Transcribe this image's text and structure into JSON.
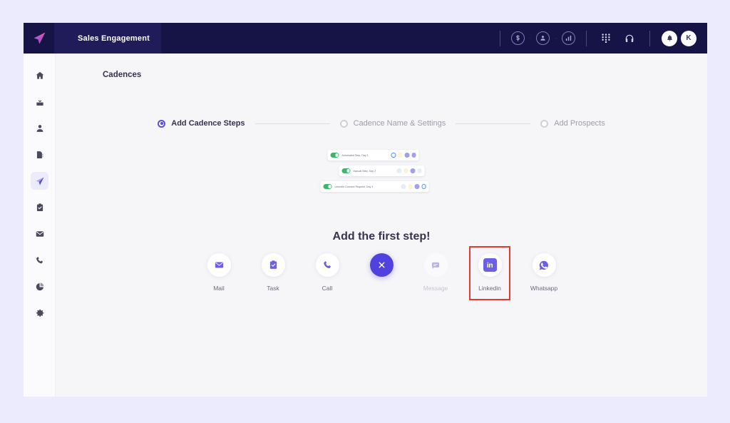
{
  "app": {
    "brand_icon": "paper-plane-logo",
    "tab_label": "Sales Engagement"
  },
  "topbar": {
    "icons": [
      {
        "name": "dollar-icon",
        "glyph": "$"
      },
      {
        "name": "person-icon",
        "glyph": "person"
      },
      {
        "name": "analytics-icon",
        "glyph": "bar-chart"
      },
      {
        "name": "dialpad-icon",
        "glyph": "dialpad"
      },
      {
        "name": "headset-icon",
        "glyph": "headset"
      }
    ],
    "notification_icon": "bell-icon",
    "avatar_initial": "K"
  },
  "sidebar": {
    "items": [
      {
        "name": "sidebar-item-home",
        "icon": "home-icon",
        "active": false
      },
      {
        "name": "sidebar-item-inbox",
        "icon": "inbox-icon",
        "active": false
      },
      {
        "name": "sidebar-item-contacts",
        "icon": "person-icon",
        "active": false
      },
      {
        "name": "sidebar-item-reports",
        "icon": "document-icon",
        "active": false
      },
      {
        "name": "sidebar-item-cadences",
        "icon": "paper-plane-icon",
        "active": true
      },
      {
        "name": "sidebar-item-tasks",
        "icon": "clipboard-icon",
        "active": false
      },
      {
        "name": "sidebar-item-mail",
        "icon": "envelope-icon",
        "active": false
      },
      {
        "name": "sidebar-item-calls",
        "icon": "phone-icon",
        "active": false
      },
      {
        "name": "sidebar-item-analytics",
        "icon": "pie-chart-icon",
        "active": false
      },
      {
        "name": "sidebar-item-settings",
        "icon": "gear-icon",
        "active": false
      }
    ]
  },
  "main": {
    "page_title": "Cadences",
    "stepper": [
      {
        "label": "Add Cadence Steps",
        "active": true
      },
      {
        "label": "Cadence Name & Settings",
        "active": false
      },
      {
        "label": "Add Prospects",
        "active": false
      }
    ],
    "illustration_cards": [
      {
        "label": "Automated Step, Day 1"
      },
      {
        "label": "Manual Step, Day 2"
      },
      {
        "label": "LinkedIn Connect Request, Day 3"
      }
    ],
    "headline": "Add the first step!",
    "channels": [
      {
        "label": "Mail",
        "icon": "mail-icon",
        "state": "enabled"
      },
      {
        "label": "Task",
        "icon": "task-icon",
        "state": "enabled"
      },
      {
        "label": "Call",
        "icon": "call-icon",
        "state": "enabled"
      },
      {
        "label": "",
        "icon": "close-icon",
        "state": "close"
      },
      {
        "label": "Message",
        "icon": "message-icon",
        "state": "disabled"
      },
      {
        "label": "Linkedin",
        "icon": "linkedin-icon",
        "state": "highlighted"
      },
      {
        "label": "Whatsapp",
        "icon": "whatsapp-icon",
        "state": "enabled"
      }
    ]
  },
  "colors": {
    "topbar_bg": "#161347",
    "tab_bg": "#201c5a",
    "accent": "#5a4ee0",
    "page_bg": "#f6f6f9",
    "outer_bg": "#ebebfd",
    "highlight_border": "#e53935"
  }
}
